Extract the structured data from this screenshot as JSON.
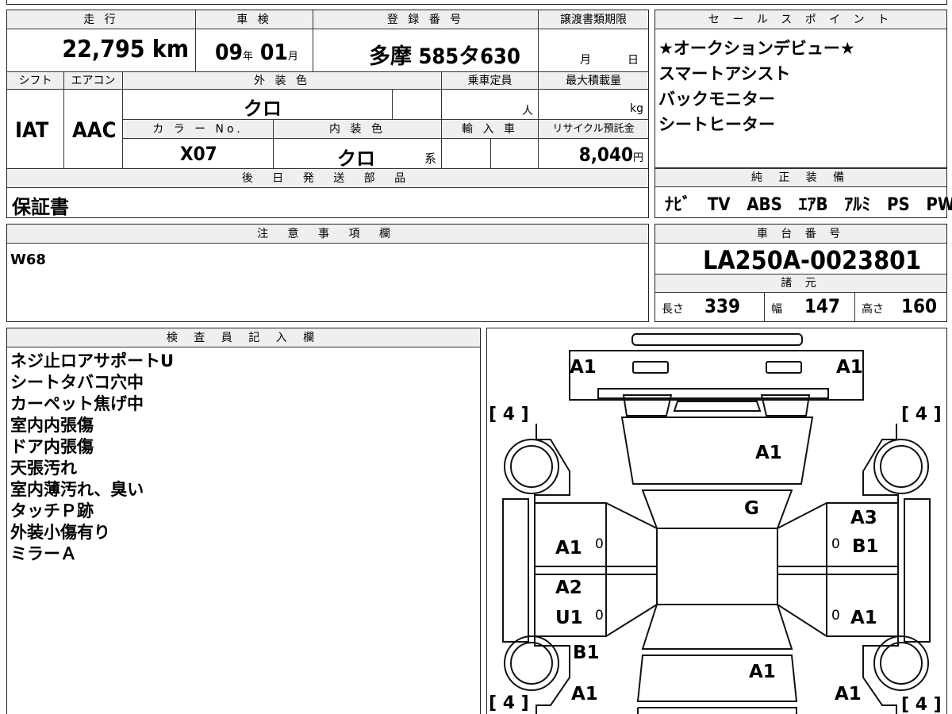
{
  "header_row": {
    "mileage_label": "走 行",
    "inspection_label": "車 検",
    "registration_label": "登 録 番 号",
    "transfer_deadline_label": "譲渡書類期限",
    "mileage_value": "22,795",
    "mileage_unit": "km",
    "inspection_year": "09",
    "year_unit": "年",
    "inspection_month": "01",
    "month_unit": "月",
    "registration_value": "多摩 585タ630",
    "deadline_month_unit": "月",
    "deadline_day_unit": "日"
  },
  "second_row": {
    "shift_label": "シフト",
    "aircon_label": "エアコン",
    "exterior_color_label": "外 装 色",
    "capacity_label": "乗車定員",
    "max_load_label": "最大積載量",
    "shift_value": "IAT",
    "aircon_value": "AAC",
    "exterior_color_value": "クロ",
    "capacity_unit": "人",
    "load_unit": "kg",
    "color_no_label": "カ ラ ー No.",
    "interior_color_label": "内 装 色",
    "import_label": "輸 入 車",
    "recycle_label": "リサイクル預託金",
    "color_no_value": "X07",
    "interior_color_value": "クロ",
    "interior_suffix": "系",
    "recycle_value": "8,040",
    "recycle_unit": "円"
  },
  "later_parts": {
    "label": "後 日 発 送 部 品",
    "value": "保証書"
  },
  "sales_points": {
    "label": "セ ー ル ス ポ イ ン ト",
    "items": [
      "★オークションデビュー★",
      "スマートアシスト",
      "バックモニター",
      "シートヒーター"
    ]
  },
  "genuine_equipment": {
    "label": "純 正 装 備",
    "items": [
      "ﾅﾋﾞ",
      "TV",
      "ABS",
      "ｴｱB",
      "ｱﾙﾐ",
      "PS",
      "PW"
    ]
  },
  "caution": {
    "label": "注 意 事 項 欄",
    "value": "W68"
  },
  "chassis": {
    "label": "車 台 番 号",
    "value": "LA250A-0023801",
    "specs_label": "諸 元",
    "length_label": "長さ",
    "length_value": "339",
    "width_label": "幅",
    "width_value": "147",
    "height_label": "高さ",
    "height_value": "160"
  },
  "inspector": {
    "label": "検 査 員 記 入 欄",
    "lines": [
      "ネジ止ロアサポートU",
      "シートタバコ穴中",
      "カーペット焦げ中",
      "室内内張傷",
      "ドア内張傷",
      "天張汚れ",
      "室内薄汚れ、臭い",
      "タッチＰ跡",
      "外装小傷有り",
      "ミラーＡ"
    ]
  },
  "diagram": {
    "front_left": "A1",
    "front_right": "A1",
    "bracket_tl": "[ 4 ]",
    "bracket_tr": "[ 4 ]",
    "bracket_bl": "[ 4 ]",
    "bracket_br": "[ 4 ]",
    "bonnet": "A1",
    "windshield": "G",
    "right_front_a": "A3",
    "right_front_b": "B1",
    "left_front_door": "A1",
    "left_rear_a": "A2",
    "left_rear_u": "U1",
    "right_rear": "A1",
    "left_quarter": "B1",
    "rear_left": "A1",
    "roof_rear": "A1",
    "rear_right": "A1",
    "zero_l1": "0",
    "zero_l2": "0",
    "zero_r1": "0",
    "zero_r2": "0"
  }
}
